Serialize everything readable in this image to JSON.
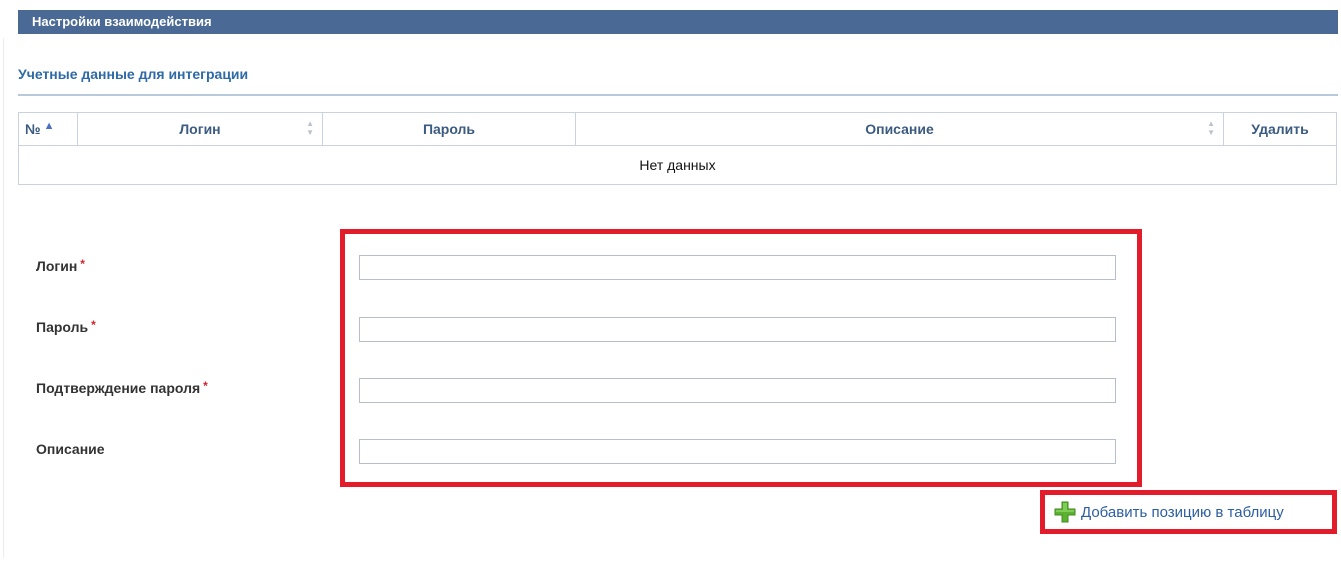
{
  "header": {
    "title": "Настройки взаимодействия"
  },
  "section": {
    "title": "Учетные данные для интеграции"
  },
  "table": {
    "columns": [
      "№",
      "Логин",
      "Пароль",
      "Описание",
      "Удалить"
    ],
    "empty_text": "Нет данных"
  },
  "form": {
    "login_label": "Логин",
    "password_label": "Пароль",
    "confirm_label": "Подтверждение пароля",
    "description_label": "Описание",
    "required_mark": "*",
    "login_value": "",
    "password_value": "",
    "confirm_value": "",
    "description_value": ""
  },
  "actions": {
    "add_label": "Добавить позицию в таблицу"
  },
  "icons": {
    "add": "plus-icon",
    "sort_asc": "sort-asc-icon",
    "sort_both": "sort-icon"
  },
  "colors": {
    "header_bg": "#4a6a95",
    "accent": "#2d6aa6",
    "highlight": "#e21c2a",
    "add_icon": "#5cb130"
  }
}
